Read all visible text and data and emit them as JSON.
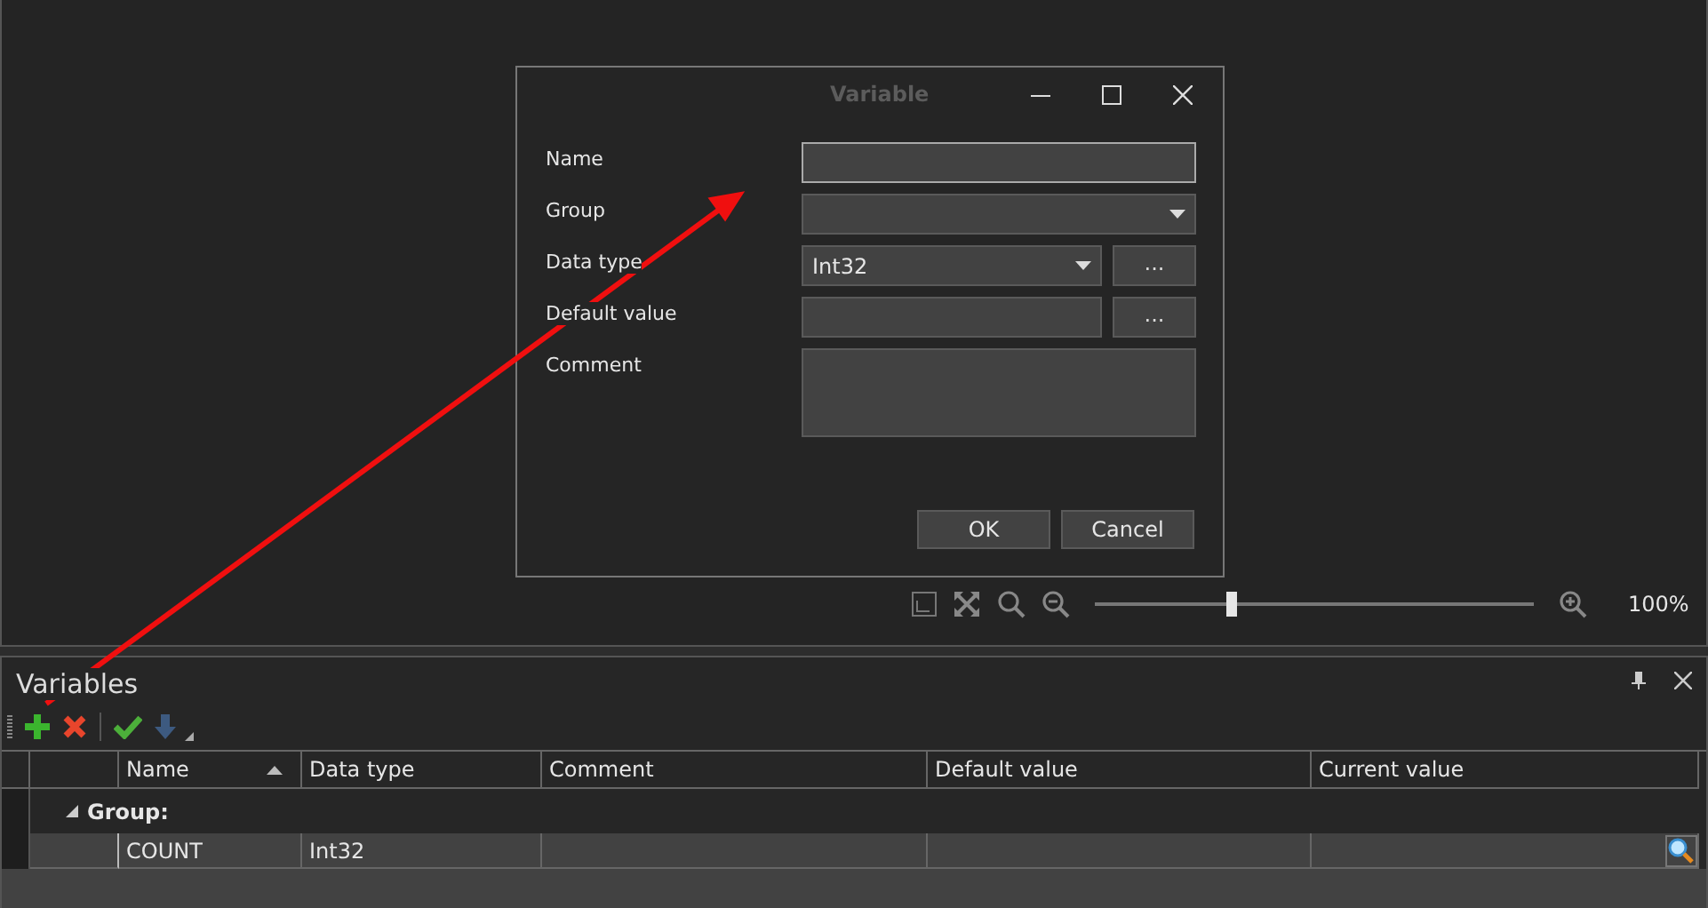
{
  "dialog": {
    "title": "Variable",
    "fields": [
      {
        "label": "Name",
        "kind": "text",
        "focused": true
      },
      {
        "label": "Group",
        "kind": "dropdown"
      },
      {
        "label": "Data type",
        "kind": "dropdown",
        "value": "Int32",
        "browse": "..."
      },
      {
        "label": "Default value",
        "kind": "text",
        "browse": "..."
      },
      {
        "label": "Comment",
        "kind": "multiline"
      }
    ],
    "buttons": [
      "OK",
      "Cancel"
    ]
  },
  "zoom": {
    "level": 0.31,
    "reading": "100%"
  },
  "panel": {
    "title": "Variables",
    "columns": [
      {
        "label": "Name",
        "sorted": true
      },
      {
        "label": "Data type",
        "sorted": false
      },
      {
        "label": "Comment",
        "sorted": false
      },
      {
        "label": "Default value",
        "sorted": false
      },
      {
        "label": "Current value",
        "sorted": false
      }
    ],
    "groups": [
      {
        "label": "Group:",
        "expanded": true,
        "rows": [
          {
            "name": "COUNT",
            "data_type": "Int32",
            "selected": true
          }
        ]
      }
    ]
  }
}
